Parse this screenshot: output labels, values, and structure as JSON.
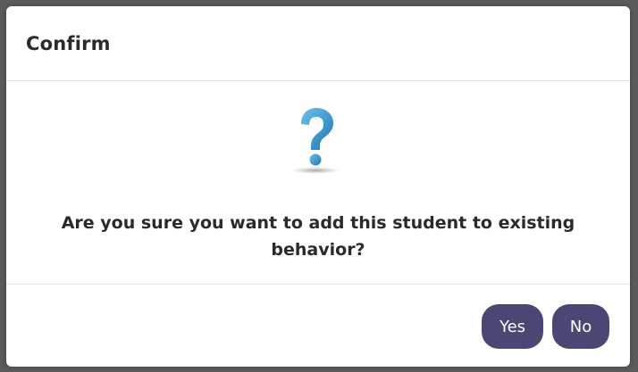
{
  "dialog": {
    "title": "Confirm",
    "icon": "question-mark-icon",
    "message": "Are you sure you want to add this student to existing behavior?",
    "buttons": {
      "yes_label": "Yes",
      "no_label": "No"
    }
  },
  "colors": {
    "button_bg": "#4a4775",
    "icon_blue": "#2f8fc8",
    "backdrop": "#5a5a5a"
  }
}
